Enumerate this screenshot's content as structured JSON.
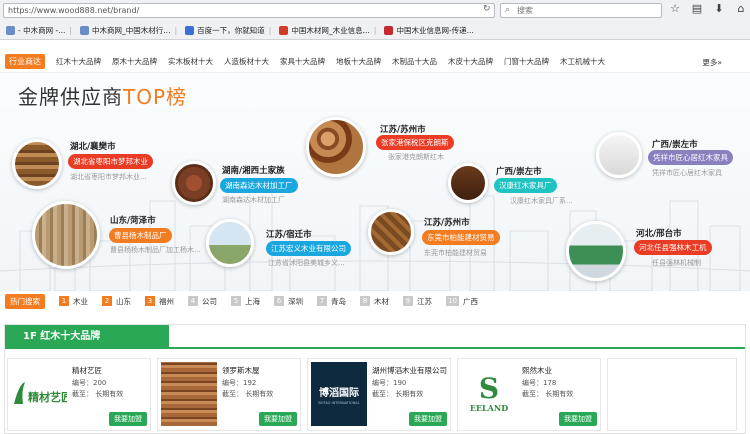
{
  "browser": {
    "url": "https://www.wood888.net/brand/",
    "search_placeholder": "搜索",
    "bookmarks": [
      {
        "label": "- 中木商网 -...",
        "color": "#6a8cc7"
      },
      {
        "label": "中木商网_中国木材行...",
        "color": "#6a8cc7"
      },
      {
        "label": "百度一下，你就知道",
        "color": "#3b6fd8"
      },
      {
        "label": "中国木材网_木业信息...",
        "color": "#d23b2a"
      },
      {
        "label": "中国木业信息网-传递...",
        "color": "#c5282f"
      }
    ]
  },
  "catnav": {
    "label": "行业商达",
    "links": [
      "红木十大品牌",
      "原木十大品牌",
      "实木板材十大",
      "人造板材十大",
      "家具十大品牌",
      "地板十大品牌",
      "木制品十大品",
      "木皮十大品牌",
      "门窗十大品牌",
      "木工机械十大"
    ],
    "more": "更多»"
  },
  "banner": {
    "title_main": "金牌供应商",
    "title_accent": "TOP榜",
    "suppliers": [
      {
        "location": "湖北/襄樊市",
        "tag": "湖北省枣阳市梦邦木业",
        "desc": "湖北省枣阳市梦邦木业...",
        "color": "#ea3b24"
      },
      {
        "location": "湖南/湘西土家族",
        "tag": "湖南森达木材加工厂",
        "desc": "湖南森达木材加工厂",
        "color": "#1aa7df"
      },
      {
        "location": "江苏/苏州市",
        "tag": "张家港保税区克朗斯",
        "desc": "张家港克朗斯红木",
        "color": "#ea3b24"
      },
      {
        "location": "广西/崇左市",
        "tag": "汉康红木家具厂",
        "desc": "汉康红木家具厂系...",
        "color": "#21c2c2"
      },
      {
        "location": "广西/崇左市",
        "tag": "凭祥市匠心居红木家具",
        "desc": "凭祥市匠心居红木家具",
        "color": "#8a7fbf"
      },
      {
        "location": "山东/菏泽市",
        "tag": "曹县杨木制品厂",
        "desc": "曹县杨杨木制品厂加工杨木...",
        "color": "#f47c20"
      },
      {
        "location": "江苏/宿迁市",
        "tag": "江苏宏义木业有限公司",
        "desc": "江苏省沭阳县美城乡义...",
        "color": "#1aa7df"
      },
      {
        "location": "江苏/苏州市",
        "tag": "东莞市柏能建材贸易",
        "desc": "东莞市柏能建材贸易",
        "color": "#f47c20"
      },
      {
        "location": "河北/邢台市",
        "tag": "河北任县强林木工机",
        "desc": "任县强林机械制",
        "color": "#ea3b24"
      }
    ]
  },
  "hot": {
    "label": "热门搜索",
    "items": [
      {
        "rank": "1",
        "text": "木业"
      },
      {
        "rank": "2",
        "text": "山东"
      },
      {
        "rank": "3",
        "text": "福州"
      },
      {
        "rank": "4",
        "text": "公司"
      },
      {
        "rank": "5",
        "text": "上海"
      },
      {
        "rank": "6",
        "text": "深圳"
      },
      {
        "rank": "7",
        "text": "青岛"
      },
      {
        "rank": "8",
        "text": "木材"
      },
      {
        "rank": "9",
        "text": "江苏"
      },
      {
        "rank": "10",
        "text": "广西"
      }
    ]
  },
  "brands": {
    "tab_label": "1F 红木十大品牌",
    "join_label": "我要加盟",
    "cards": [
      {
        "name": "精材艺匠",
        "num": "编号：200",
        "exp": "截至：  长期有效",
        "logo_text": "精材艺匠"
      },
      {
        "name": "领罗斯木屋",
        "num": "编号：192",
        "exp": "截至：  长期有效",
        "logo_text": ""
      },
      {
        "name": "湖州博滔木业有限公司",
        "num": "编号：190",
        "exp": "截至：  长期有效",
        "logo_text": "博滔国际",
        "logo_sub": "BOTAO INTERNATIONAL"
      },
      {
        "name": "熙然木业",
        "num": "编号：178",
        "exp": "截至：  长期有效",
        "logo_text": "EELAND",
        "logo_letter": "S"
      }
    ]
  }
}
